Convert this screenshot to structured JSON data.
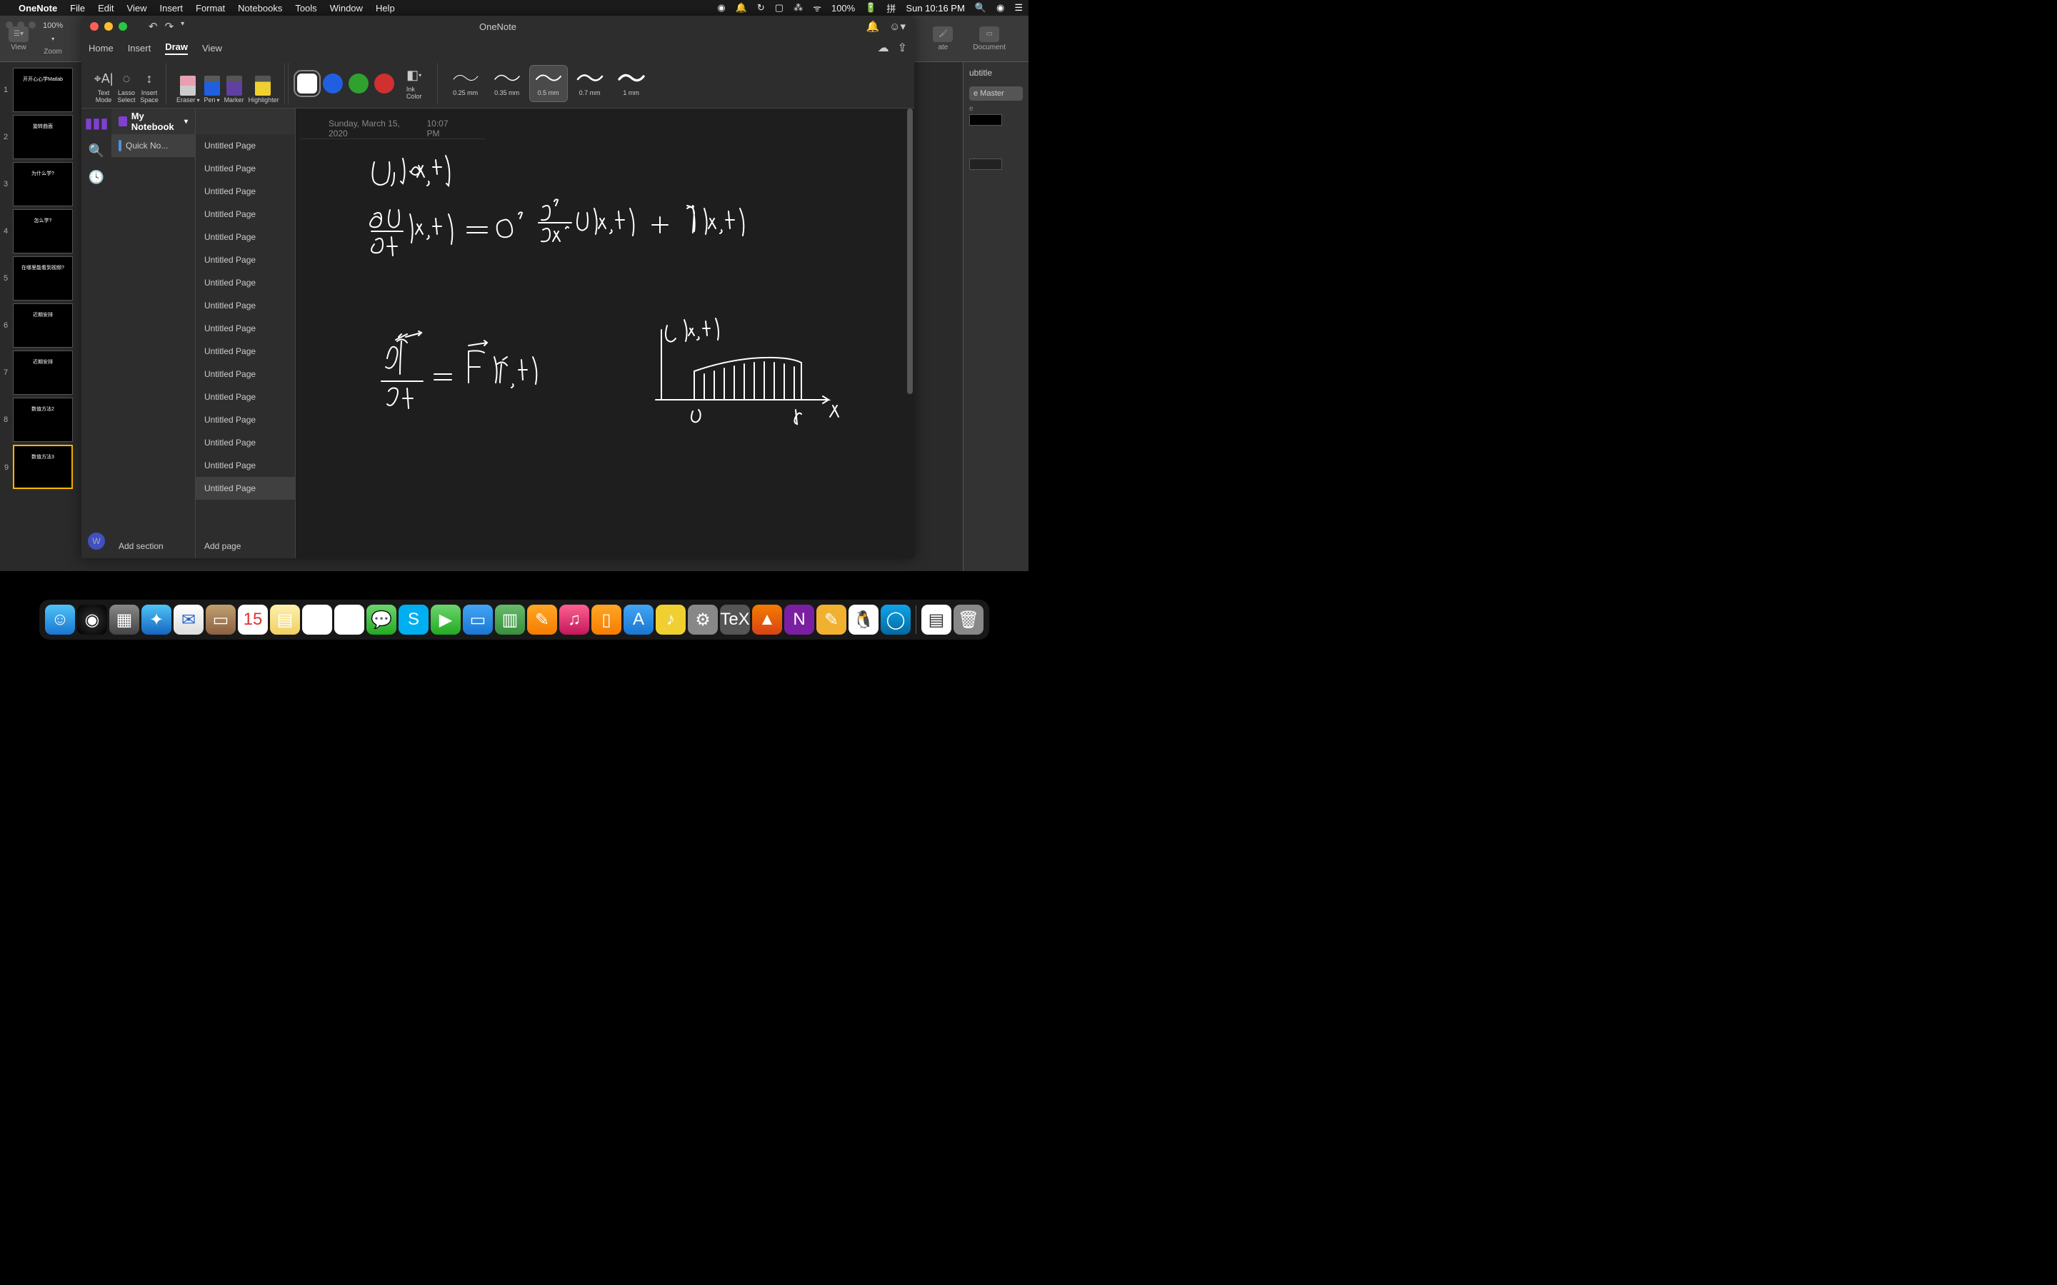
{
  "menubar": {
    "app": "OneNote",
    "items": [
      "File",
      "Edit",
      "View",
      "Insert",
      "Format",
      "Notebooks",
      "Tools",
      "Window",
      "Help"
    ],
    "battery": "100%",
    "clock": "Sun 10:16 PM"
  },
  "bgapp": {
    "view_label": "View",
    "zoom_label": "Zoom",
    "zoom_value": "100%",
    "right_tabs": {
      "format": "ate",
      "document": "Document"
    },
    "subtitle_label": "ubtitle",
    "master_label": "e Master",
    "slides": [
      {
        "n": "1",
        "title": "开开心心学Matlab"
      },
      {
        "n": "2",
        "title": "旋转曲面"
      },
      {
        "n": "3",
        "title": "为什么学?"
      },
      {
        "n": "4",
        "title": "怎么学?"
      },
      {
        "n": "5",
        "title": "在哪里能看到视频?"
      },
      {
        "n": "6",
        "title": "近期安排"
      },
      {
        "n": "7",
        "title": "近期安排"
      },
      {
        "n": "8",
        "title": "数值方法2"
      },
      {
        "n": "9",
        "title": "数值方法3"
      }
    ]
  },
  "window": {
    "title": "OneNote"
  },
  "ribbon": {
    "tabs": [
      "Home",
      "Insert",
      "Draw",
      "View"
    ],
    "active_tab": "Draw",
    "tools": {
      "text_mode": "Text\nMode",
      "lasso": "Lasso\nSelect",
      "insert_space": "Insert\nSpace",
      "eraser": "Eraser",
      "pen": "Pen",
      "marker": "Marker",
      "highlighter": "Highlighter",
      "ink_color": "Ink\nColor"
    },
    "strokes": [
      "0.25 mm",
      "0.35 mm",
      "0.5 mm",
      "0.7 mm",
      "1 mm"
    ],
    "selected_stroke": "0.5 mm"
  },
  "notebook": {
    "name": "My Notebook",
    "section": "Quick No...",
    "add_section": "Add section",
    "add_page": "Add page",
    "avatar": "W"
  },
  "pages": [
    "Untitled Page",
    "Untitled Page",
    "Untitled Page",
    "Untitled Page",
    "Untitled Page",
    "Untitled Page",
    "Untitled Page",
    "Untitled Page",
    "Untitled Page",
    "Untitled Page",
    "Untitled Page",
    "Untitled Page",
    "Untitled Page",
    "Untitled Page",
    "Untitled Page",
    "Untitled Page"
  ],
  "active_page_index": 15,
  "page": {
    "date": "Sunday, March 15, 2020",
    "time": "10:07 PM"
  },
  "dock": {
    "items": [
      {
        "name": "finder",
        "cls": "di-finder",
        "glyph": "☺"
      },
      {
        "name": "siri",
        "cls": "di-siri",
        "glyph": "◉"
      },
      {
        "name": "launchpad",
        "cls": "di-launch",
        "glyph": "▦"
      },
      {
        "name": "safari",
        "cls": "di-safari",
        "glyph": "✦"
      },
      {
        "name": "mail",
        "cls": "di-mail",
        "glyph": "✉"
      },
      {
        "name": "contacts",
        "cls": "di-contacts",
        "glyph": "▭"
      },
      {
        "name": "calendar",
        "cls": "di-cal",
        "glyph": "15"
      },
      {
        "name": "notes",
        "cls": "di-notes",
        "glyph": "▤"
      },
      {
        "name": "reminders",
        "cls": "di-rem",
        "glyph": "☑"
      },
      {
        "name": "photos",
        "cls": "di-photos",
        "glyph": "✿"
      },
      {
        "name": "messages",
        "cls": "di-msg",
        "glyph": "💬"
      },
      {
        "name": "skype",
        "cls": "di-skype",
        "glyph": "S"
      },
      {
        "name": "facetime",
        "cls": "di-ft",
        "glyph": "▶"
      },
      {
        "name": "keynote",
        "cls": "di-key",
        "glyph": "▭"
      },
      {
        "name": "numbers",
        "cls": "di-num",
        "glyph": "▥"
      },
      {
        "name": "pages",
        "cls": "di-page",
        "glyph": "✎"
      },
      {
        "name": "music",
        "cls": "di-music",
        "glyph": "♫"
      },
      {
        "name": "books",
        "cls": "di-books",
        "glyph": "▯"
      },
      {
        "name": "appstore",
        "cls": "di-store",
        "glyph": "A"
      },
      {
        "name": "netease",
        "cls": "di-nm",
        "glyph": "♪"
      },
      {
        "name": "preferences",
        "cls": "di-pref",
        "glyph": "⚙"
      },
      {
        "name": "texshop",
        "cls": "di-tex",
        "glyph": "TeX"
      },
      {
        "name": "matlab",
        "cls": "di-matlab",
        "glyph": "▲"
      },
      {
        "name": "onenote",
        "cls": "di-on",
        "glyph": "N"
      },
      {
        "name": "notability",
        "cls": "di-note2",
        "glyph": "✎"
      },
      {
        "name": "qq",
        "cls": "di-qq",
        "glyph": "🐧"
      },
      {
        "name": "browser",
        "cls": "di-edge",
        "glyph": "◯"
      }
    ],
    "right": [
      {
        "name": "document",
        "cls": "di-doc",
        "glyph": "▤"
      },
      {
        "name": "trash",
        "cls": "di-trash",
        "glyph": "🗑"
      }
    ]
  }
}
